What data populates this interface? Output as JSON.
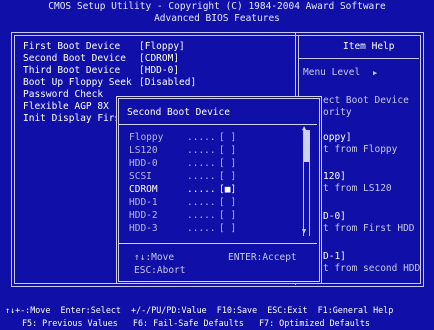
{
  "header": {
    "title": "CMOS Setup Utility - Copyright (C) 1984-2004 Award Software",
    "subtitle": "Advanced BIOS Features"
  },
  "settings": [
    {
      "label": "First Boot Device",
      "value": "[Floppy]"
    },
    {
      "label": "Second Boot Device",
      "value": "[CDROM]"
    },
    {
      "label": "Third Boot Device",
      "value": "[HDD-0]"
    },
    {
      "label": "Boot Up Floppy Seek",
      "value": "[Disabled]"
    },
    {
      "label": "Password Check",
      "value": ""
    },
    {
      "label": "Flexible AGP 8X",
      "value": ""
    },
    {
      "label": "Init Display Firs",
      "value": ""
    }
  ],
  "help": {
    "title": "Item Help",
    "menu_level": "Menu Level",
    "menu_level_arrow": "▶",
    "lines": [
      "ect Boot Device",
      "ority",
      "",
      "oppy]",
      "t from Floppy",
      "",
      "120]",
      "t from LS120",
      "",
      "D-0]",
      "t from First HDD",
      "",
      "D-1]",
      "t from second HDD"
    ]
  },
  "popup": {
    "title": "Second Boot Device",
    "options": [
      {
        "label": "Floppy",
        "dots": ".....",
        "mark": "[ ]"
      },
      {
        "label": "LS120",
        "dots": ".....",
        "mark": "[ ]"
      },
      {
        "label": "HDD-0",
        "dots": ".....",
        "mark": "[ ]"
      },
      {
        "label": "SCSI",
        "dots": ".....",
        "mark": "[ ]"
      },
      {
        "label": "CDROM",
        "dots": ".....",
        "mark": "[■]"
      },
      {
        "label": "HDD-1",
        "dots": ".....",
        "mark": "[ ]"
      },
      {
        "label": "HDD-2",
        "dots": ".....",
        "mark": "[ ]"
      },
      {
        "label": "HDD-3",
        "dots": ".....",
        "mark": "[ ]"
      }
    ],
    "hint_move": "↑↓:Move",
    "hint_accept": "ENTER:Accept",
    "hint_abort": "ESC:Abort",
    "scroll_up": "▲",
    "scroll_down": "▼"
  },
  "footer": {
    "line1": "↑↓+-:Move  Enter:Select  +/-/PU/PD:Value  F10:Save  ESC:Exit  F1:General Help",
    "line2": "F5: Previous Values   F6: Fail-Safe Defaults   F7: Optimized Defaults"
  }
}
